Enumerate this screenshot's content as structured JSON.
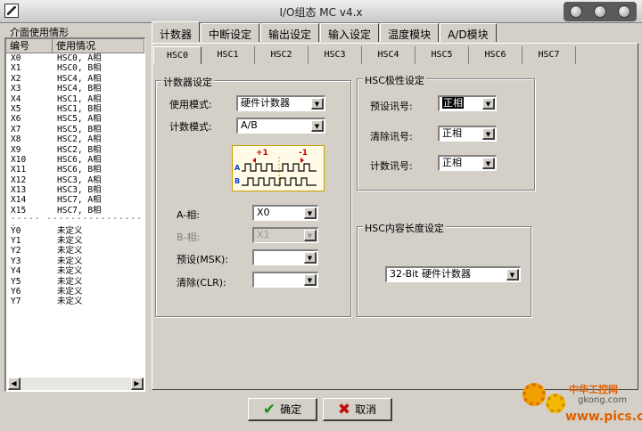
{
  "window": {
    "title": "I/O组态 MC v4.x"
  },
  "left_panel": {
    "title": "介面使用情形",
    "columns": [
      "编号",
      "使用情况"
    ],
    "rows_x": [
      [
        "X0",
        "HSC0, A相"
      ],
      [
        "X1",
        "HSC0, B相"
      ],
      [
        "X2",
        "HSC4, A相"
      ],
      [
        "X3",
        "HSC4, B相"
      ],
      [
        "X4",
        "HSC1, A相"
      ],
      [
        "X5",
        "HSC1, B相"
      ],
      [
        "X6",
        "HSC5, A相"
      ],
      [
        "X7",
        "HSC5, B相"
      ],
      [
        "X8",
        "HSC2, A相"
      ],
      [
        "X9",
        "HSC2, B相"
      ],
      [
        "X10",
        "HSC6, A相"
      ],
      [
        "X11",
        "HSC6, B相"
      ],
      [
        "X12",
        "HSC3, A相"
      ],
      [
        "X13",
        "HSC3, B相"
      ],
      [
        "X14",
        "HSC7, A相"
      ],
      [
        "X15",
        "HSC7, B相"
      ]
    ],
    "separator": "-----  -----------------",
    "rows_y": [
      [
        "Y0",
        "未定义"
      ],
      [
        "Y1",
        "未定义"
      ],
      [
        "Y2",
        "未定义"
      ],
      [
        "Y3",
        "未定义"
      ],
      [
        "Y4",
        "未定义"
      ],
      [
        "Y5",
        "未定义"
      ],
      [
        "Y6",
        "未定义"
      ],
      [
        "Y7",
        "未定义"
      ]
    ]
  },
  "tabs": [
    "计数器",
    "中断设定",
    "输出设定",
    "输入设定",
    "温度模块",
    "A/D模块"
  ],
  "subtabs": [
    "HSC0",
    "HSC1",
    "HSC2",
    "HSC3",
    "HSC4",
    "HSC5",
    "HSC6",
    "HSC7"
  ],
  "counter_settings": {
    "group_title": "计数器设定",
    "use_mode_label": "使用模式:",
    "use_mode_value": "硬件计数器",
    "count_mode_label": "计数模式:",
    "count_mode_value": "A/B",
    "diagram": {
      "plus_label": "+1",
      "minus_label": "-1",
      "a_label": "A",
      "b_label": "B"
    },
    "a_phase_label": "A-相:",
    "a_phase_value": "X0",
    "b_phase_label": "B-相:",
    "b_phase_value": "X1",
    "preset_label": "预设(MSK):",
    "preset_value": "",
    "clear_label": "清除(CLR):",
    "clear_value": ""
  },
  "polarity": {
    "group_title": "HSC极性设定",
    "preset_signal_label": "预设讯号:",
    "preset_signal_value": "正相",
    "clear_signal_label": "清除讯号:",
    "clear_signal_value": "正相",
    "count_signal_label": "计数讯号:",
    "count_signal_value": "正相"
  },
  "length": {
    "group_title": "HSC内容长度设定",
    "value": "32-Bit 硬件计数器"
  },
  "buttons": {
    "ok": "确定",
    "cancel": "取消"
  },
  "watermark": {
    "line1": "中华工控网",
    "line2": "gkong.com",
    "line3": "www.pics.cn"
  },
  "colors": {
    "window_bg": "#d4d0c8",
    "ok_icon": "#1a8f1a",
    "cancel_icon": "#c01010"
  }
}
